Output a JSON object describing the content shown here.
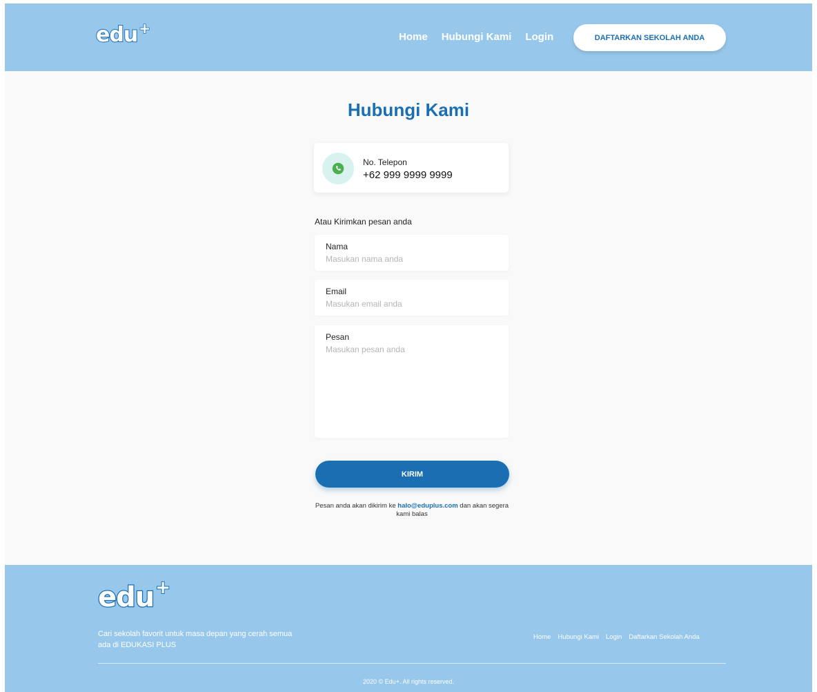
{
  "header": {
    "logo_text": "edu",
    "logo_plus": "+",
    "nav": [
      "Home",
      "Hubungi Kami",
      "Login"
    ],
    "cta_label": "DAFTARKAN SEKOLAH ANDA"
  },
  "main": {
    "title": "Hubungi Kami",
    "contact": {
      "icon": "whatsapp-icon",
      "label": "No. Telepon",
      "value": "+62 999 9999 9999"
    },
    "form_heading": "Atau Kirimkan pesan anda",
    "fields": {
      "nama": {
        "label": "Nama",
        "placeholder": "Masukan nama anda"
      },
      "email": {
        "label": "Email",
        "placeholder": "Masukan email anda"
      },
      "pesan": {
        "label": "Pesan",
        "placeholder": "Masukan pesan anda"
      }
    },
    "submit_label": "KIRIM",
    "note": {
      "prefix": "Pesan anda akan dikirim ke ",
      "email": "halo@eduplus.com",
      "suffix": " dan akan segera kami balas"
    }
  },
  "footer": {
    "logo_text": "edu",
    "logo_plus": "+",
    "tagline": "Cari sekolah favorit untuk masa depan yang cerah semua ada di EDUKASI PLUS",
    "nav": [
      "Home",
      "Hubungi Kami",
      "Login",
      "Daftarkan Sekolah Anda"
    ],
    "copyright": "2020 © Edu+. All rights reserved."
  },
  "colors": {
    "header_bg": "#97c8eb",
    "primary": "#1a6fb3",
    "page_bg": "#f9f9f9",
    "whatsapp_green": "#4caf50"
  }
}
